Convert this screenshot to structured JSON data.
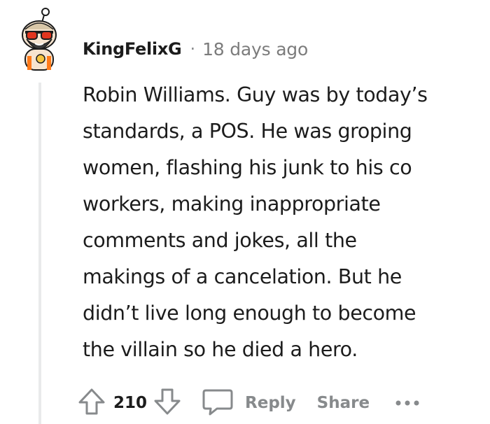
{
  "comment": {
    "author": "KingFelixG",
    "separator": "·",
    "timestamp": "18 days ago",
    "lines": [
      "Robin Williams. Guy was by today’s",
      "standards, a POS. He was groping",
      "women, flashing his junk to his co",
      "workers, making inappropriate",
      "comments and jokes, all the",
      "makings of a cancelation. But he",
      "didn’t live long enough to become",
      "the villain so he died a hero."
    ]
  },
  "actions": {
    "vote_count": "210",
    "reply_label": "Reply",
    "share_label": "Share",
    "upvote_icon": "arrow-up-outline-icon",
    "downvote_icon": "arrow-down-outline-icon",
    "reply_icon": "speech-bubble-icon",
    "more_icon": "horizontal-ellipsis-icon"
  },
  "colors": {
    "text": "#1c1c1c",
    "muted": "#7c7c7c",
    "action": "#878a8c",
    "thread_line": "#e9eaeb"
  }
}
